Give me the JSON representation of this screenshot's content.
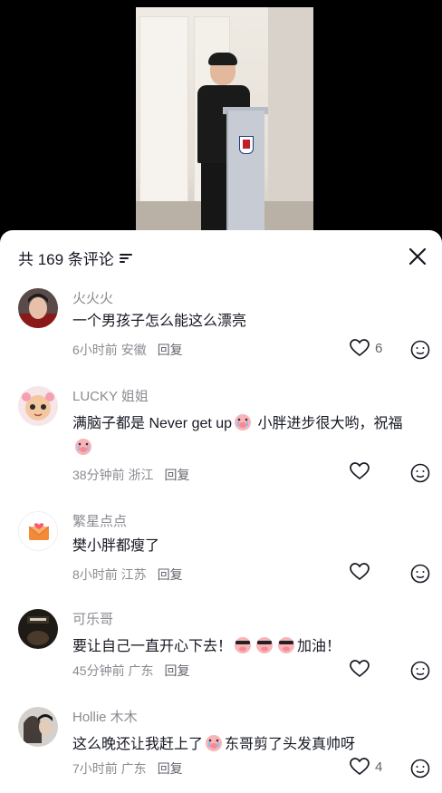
{
  "sheet": {
    "title": "共 169 条评论"
  },
  "comments": [
    {
      "name": "火火火",
      "text": "一个男孩子怎么能这么漂亮",
      "time": "6小时前",
      "location": "安徽",
      "reply": "回复",
      "likes": "6"
    },
    {
      "name": "LUCKY 姐姐",
      "text_a": "满脑子都是 Never get up",
      "text_b": " 小胖进步很大哟，祝福",
      "time": "38分钟前",
      "location": "浙江",
      "reply": "回复",
      "likes": ""
    },
    {
      "name": "繁星点点",
      "text": "樊小胖都瘦了",
      "time": "8小时前",
      "location": "江苏",
      "reply": "回复",
      "likes": ""
    },
    {
      "name": "可乐哥",
      "text_a": "要让自己一直开心下去！",
      "text_b": "加油！",
      "time": "45分钟前",
      "location": "广东",
      "reply": "回复",
      "likes": ""
    },
    {
      "name": "Hollie 木木",
      "text_a": "这么晚还让我赶上了",
      "text_b": "东哥剪了头发真帅呀",
      "time": "7小时前",
      "location": "广东",
      "reply": "回复",
      "likes": "4"
    }
  ],
  "icons": {
    "filter": "filter-icon",
    "close": "close-icon",
    "heart": "heart-icon",
    "reaction": "emoji-reaction-icon"
  },
  "colors": {
    "text_primary": "#161823",
    "text_secondary": "#8a8b91",
    "background": "#ffffff"
  }
}
